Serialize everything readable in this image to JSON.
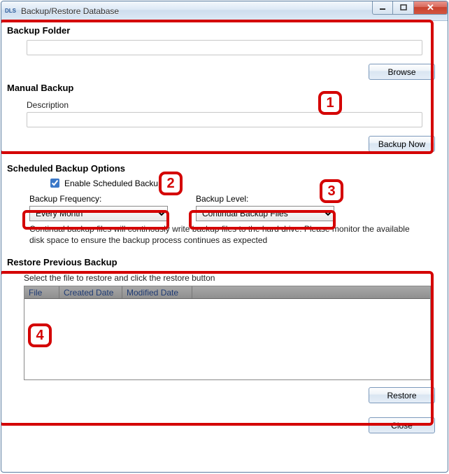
{
  "titlebar": {
    "icon_text": "DLS",
    "title": "Backup/Restore Database"
  },
  "backup_folder": {
    "heading": "Backup Folder",
    "path_value": "",
    "browse_label": "Browse"
  },
  "manual_backup": {
    "heading": "Manual Backup",
    "description_label": "Description",
    "description_value": "",
    "backup_now_label": "Backup Now"
  },
  "scheduled": {
    "heading": "Scheduled Backup Options",
    "enable_label": "Enable Scheduled Backup",
    "enable_checked": true,
    "frequency_label": "Backup Frequency:",
    "frequency_value": "Every Month",
    "level_label": "Backup Level:",
    "level_value": "Continual Backup Files",
    "helper_text": "Continual backup files will continously write backup files to the hard drive.   Please monitor the available disk space to ensure the backup process continues as expected"
  },
  "restore": {
    "heading": "Restore Previous Backup",
    "instruction": "Select the file to restore and click the restore button",
    "columns": {
      "file": "File",
      "created": "Created Date",
      "modified": "Modified Date"
    },
    "rows": [],
    "restore_label": "Restore"
  },
  "footer": {
    "close_label": "Close"
  },
  "annotations": {
    "a1": "1",
    "a2": "2",
    "a3": "3",
    "a4": "4"
  }
}
